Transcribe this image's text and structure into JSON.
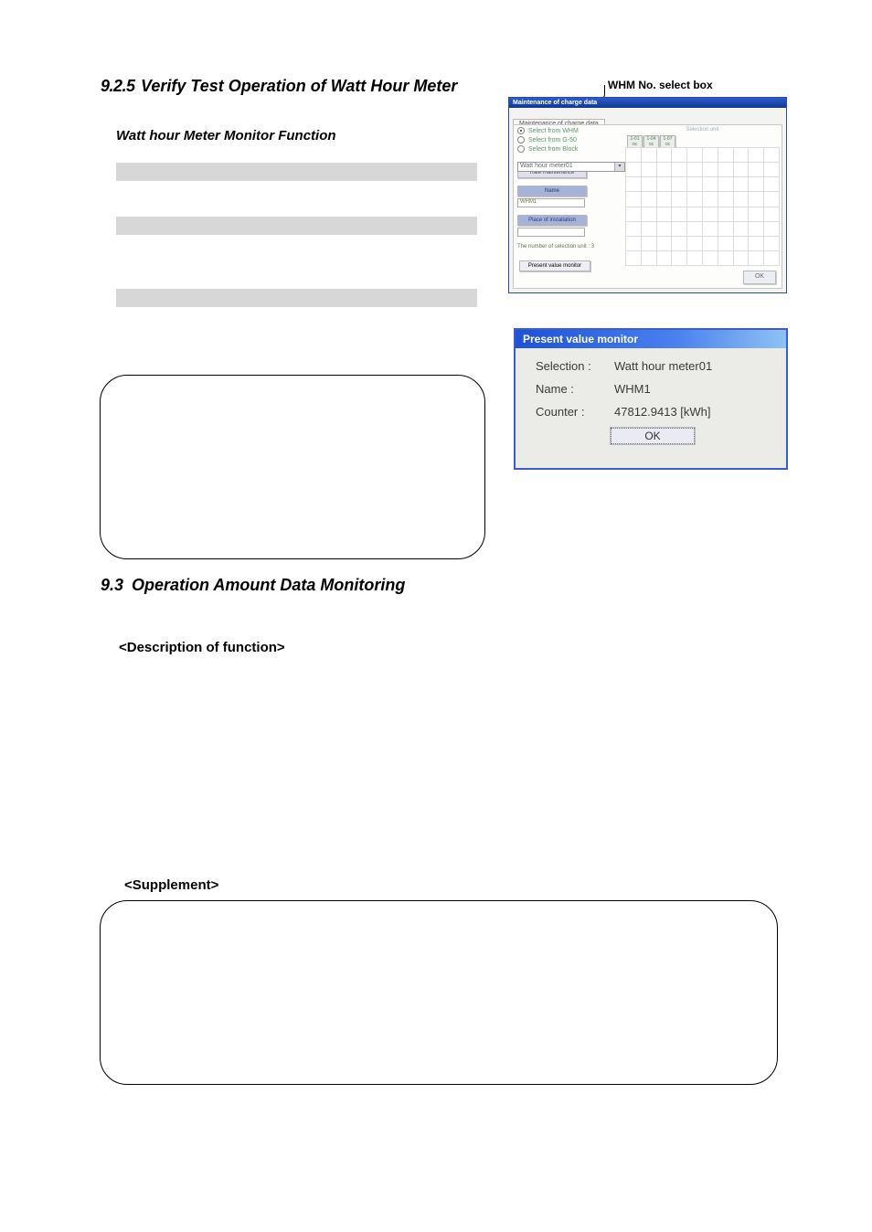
{
  "section925": {
    "number": "9.2.5",
    "title": "Verify Test Operation of Watt Hour Meter"
  },
  "whm_caption": "WHM No. select box",
  "subtitle": "Watt hour Meter Monitor Function",
  "panel": {
    "title": "Maintenance of charge data",
    "radios": {
      "whm": "Select from WHM",
      "g50": "Select from G-50",
      "block": "Select from Block"
    },
    "select_value": "Watt hour meter01",
    "rate_btn": "Rate maintenance",
    "name_btn": "Name",
    "name_value": "WHM1",
    "place_btn": "Place of installation",
    "count_label": "The number of selection unit : 3",
    "pv_btn": "Present value monitor",
    "sel_unit_title": "Selection unit",
    "chips": [
      {
        "id": "1-01",
        "model": "oc"
      },
      {
        "id": "1-04",
        "model": "oc"
      },
      {
        "id": "1-07",
        "model": "oc"
      }
    ],
    "ok": "OK"
  },
  "pv_dialog": {
    "title": "Present value monitor",
    "rows": {
      "selection_k": "Selection :",
      "selection_v": "Watt hour meter01",
      "name_k": "Name :",
      "name_v": "WHM1",
      "counter_k": "Counter :",
      "counter_v": "47812.9413 [kWh]"
    },
    "ok": "OK"
  },
  "section93": {
    "number": "9.3",
    "title_rest": "Operation Amount Data Monitoring"
  },
  "desc_label": "<Description of function>",
  "supp_label": "<Supplement>"
}
